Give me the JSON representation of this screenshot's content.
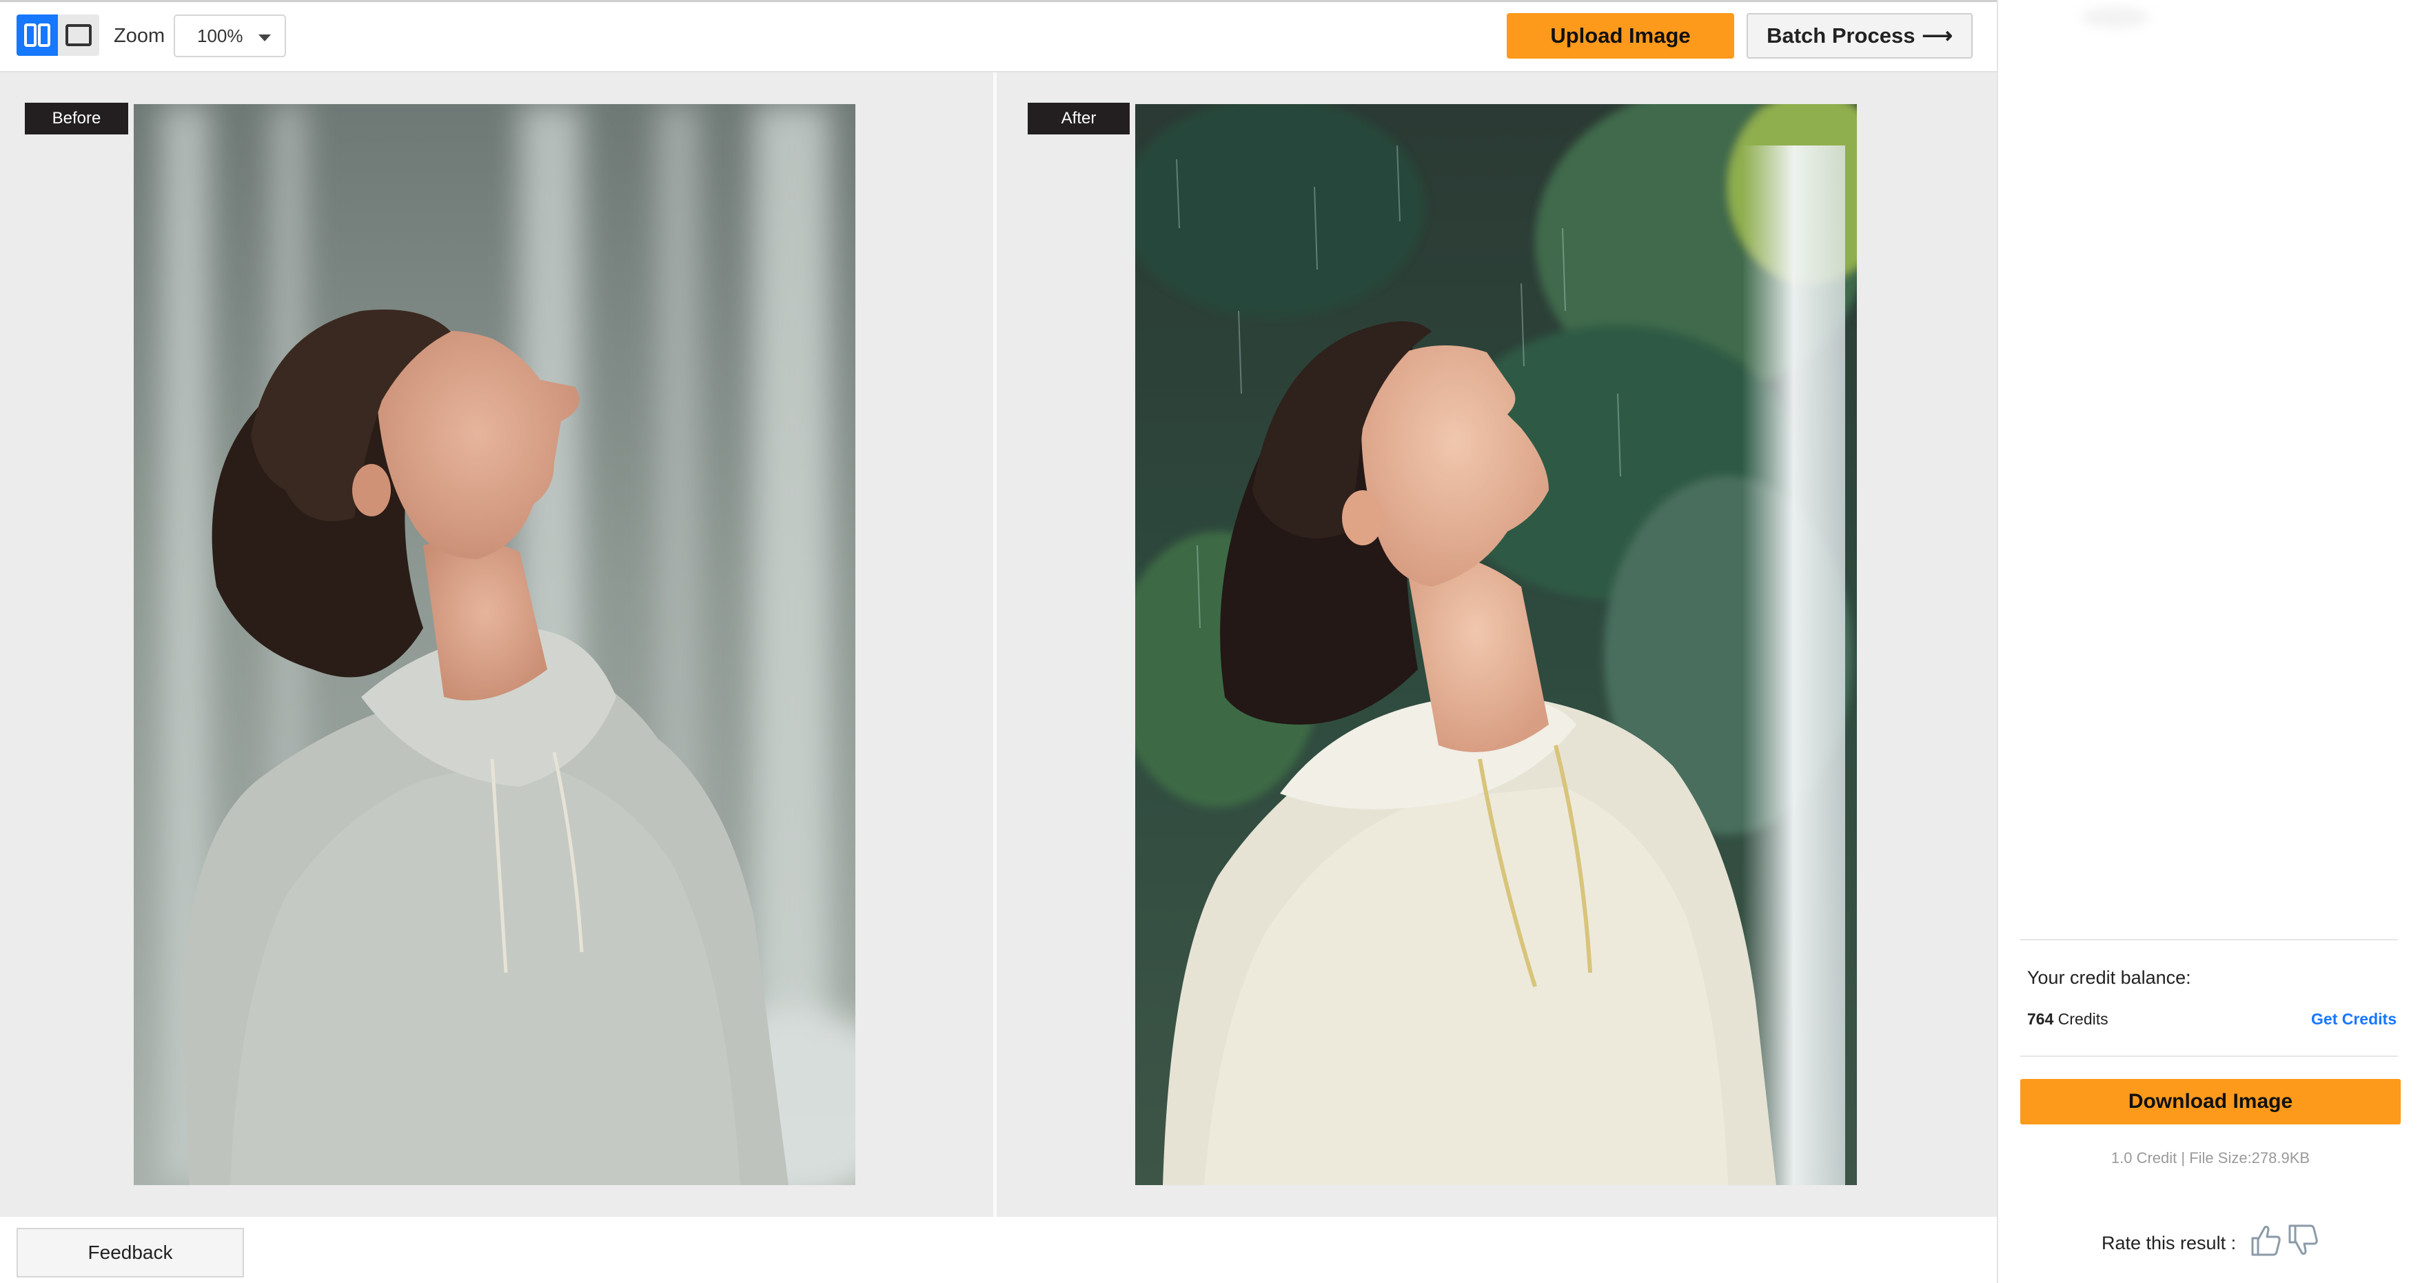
{
  "toolbar": {
    "zoom_label": "Zoom",
    "zoom_value": "100%",
    "upload_label": "Upload Image",
    "batch_label": "Batch Process",
    "batch_arrow": "⟶"
  },
  "compare": {
    "before_label": "Before",
    "after_label": "After"
  },
  "feedback_label": "Feedback",
  "panel": {
    "credit_label": "Your credit balance:",
    "credit_count": "764",
    "credit_unit": " Credits",
    "get_credits": "Get Credits",
    "download_label": "Download Image",
    "file_info": "1.0 Credit | File Size:278.9KB",
    "rate_label": "Rate this result :"
  },
  "icons": {
    "split_view": "split-view-icon",
    "single_view": "single-view-icon",
    "dropdown": "chevron-down-icon",
    "thumbs_up": "thumbs-up-icon",
    "thumbs_down": "thumbs-down-icon"
  },
  "colors": {
    "accent_orange": "#fd9a1b",
    "accent_blue": "#1677ff",
    "badge_dark": "#231f20"
  }
}
